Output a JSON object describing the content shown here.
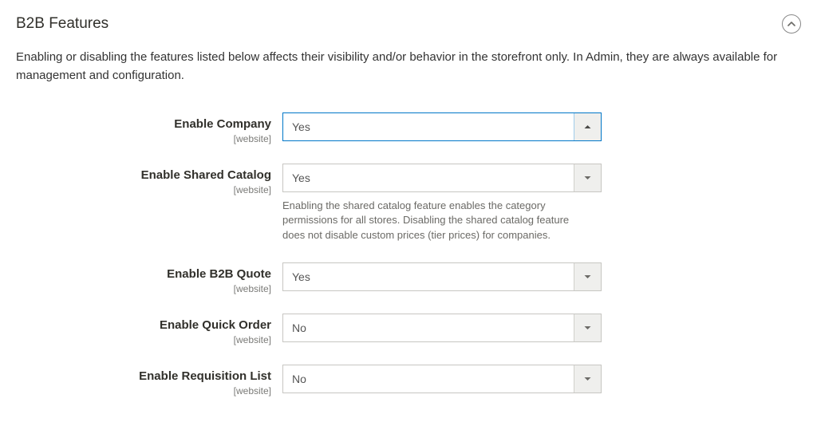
{
  "section": {
    "title": "B2B Features",
    "description": "Enabling or disabling the features listed below affects their visibility and/or behavior in the storefront only. In Admin, they are always available for management and configuration."
  },
  "fields": {
    "enable_company": {
      "label": "Enable Company",
      "scope": "[website]",
      "value": "Yes",
      "open": true
    },
    "enable_shared_catalog": {
      "label": "Enable Shared Catalog",
      "scope": "[website]",
      "value": "Yes",
      "help": "Enabling the shared catalog feature enables the category permissions for all stores. Disabling the shared catalog feature does not disable custom prices (tier prices) for companies."
    },
    "enable_b2b_quote": {
      "label": "Enable B2B Quote",
      "scope": "[website]",
      "value": "Yes"
    },
    "enable_quick_order": {
      "label": "Enable Quick Order",
      "scope": "[website]",
      "value": "No"
    },
    "enable_requisition_list": {
      "label": "Enable Requisition List",
      "scope": "[website]",
      "value": "No"
    }
  }
}
